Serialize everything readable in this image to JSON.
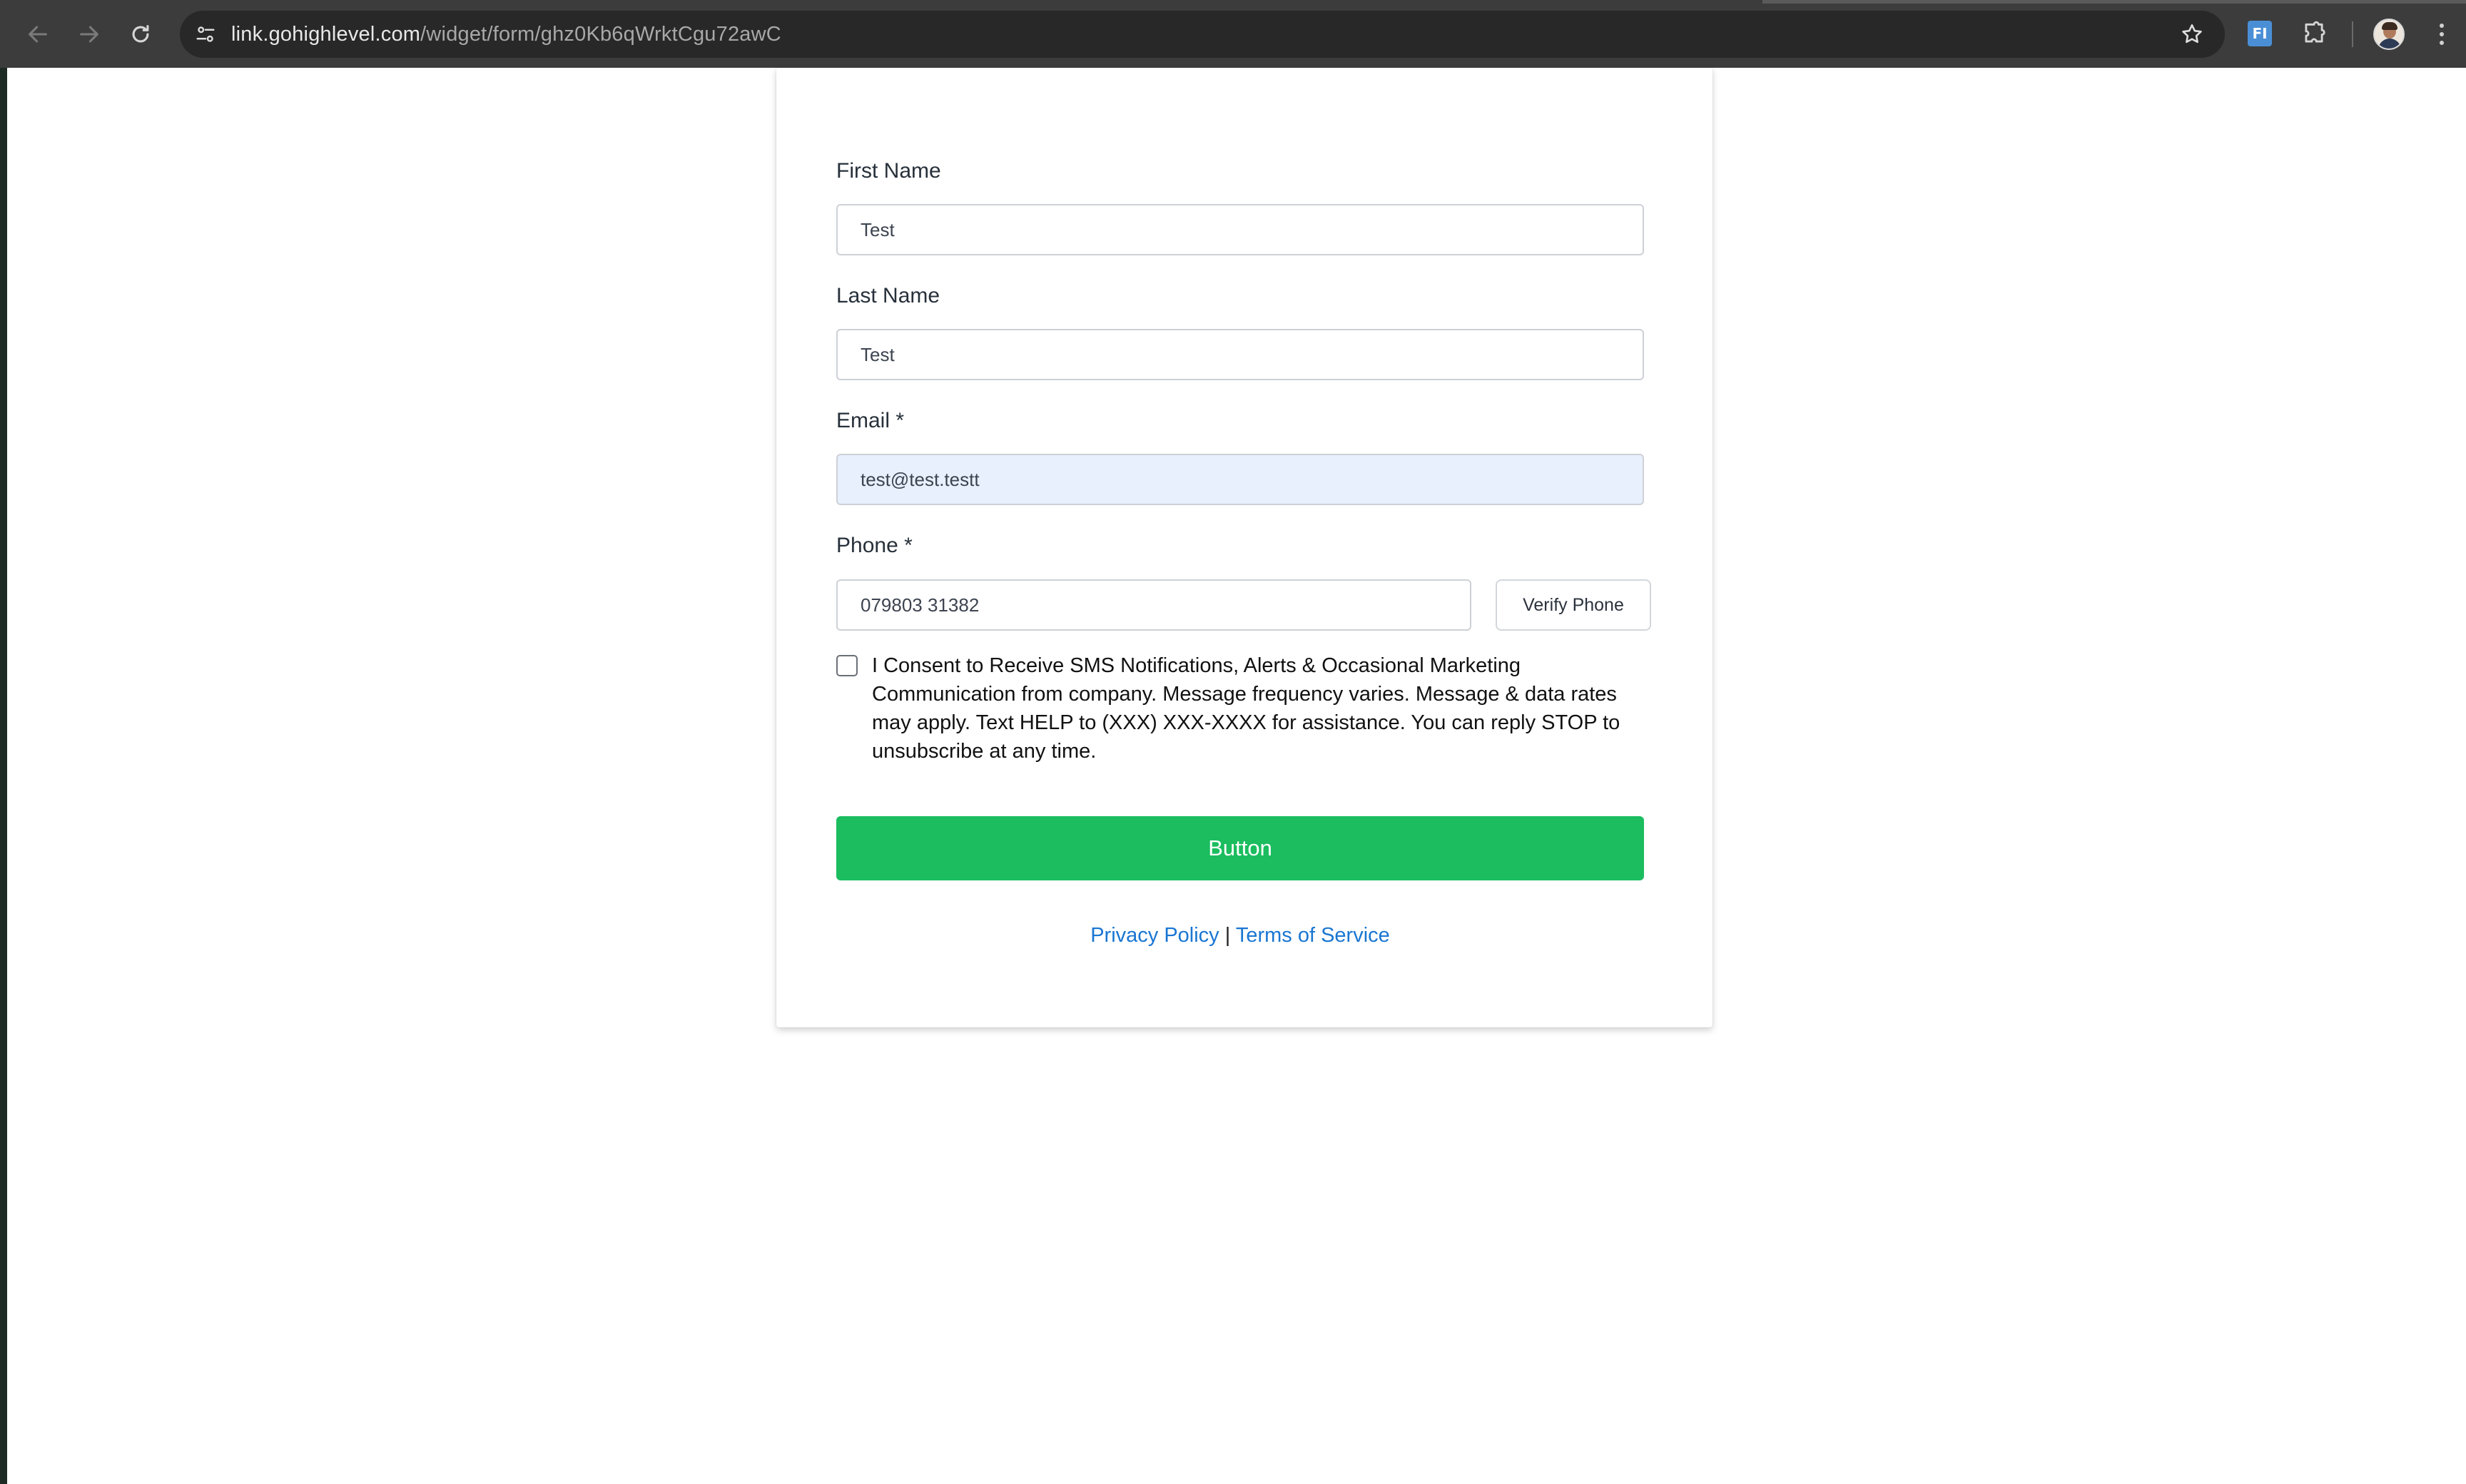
{
  "browser": {
    "url_host": "link.gohighlevel.com",
    "url_path": "/widget/form/ghz0Kb6qWrktCgu72awC",
    "extension_label": "FI",
    "icons": [
      "back-icon",
      "forward-icon",
      "reload-icon",
      "site-info-icon",
      "bookmark-star-icon",
      "extensions-icon",
      "profile-avatar",
      "menu-icon"
    ]
  },
  "form": {
    "first_name_label": "First Name",
    "first_name_value": "Test",
    "last_name_label": "Last Name",
    "last_name_value": "Test",
    "email_label": "Email *",
    "email_value": "test@test.testt",
    "phone_label": "Phone *",
    "phone_value": "079803 31382",
    "verify_phone_label": "Verify Phone",
    "consent_text": "I Consent to Receive SMS Notifications, Alerts & Occasional Marketing Communication from company. Message frequency varies. Message & data rates may apply. Text HELP to (XXX) XXX-XXXX for assistance. You can reply STOP to unsubscribe at any time.",
    "consent_checked": false,
    "submit_label": "Button",
    "privacy_link": "Privacy Policy",
    "separator": "|",
    "terms_link": "Terms of Service"
  },
  "colors": {
    "submit_bg": "#1bbd5f",
    "link": "#1976d2",
    "autofill_bg": "#e8f0fe"
  }
}
